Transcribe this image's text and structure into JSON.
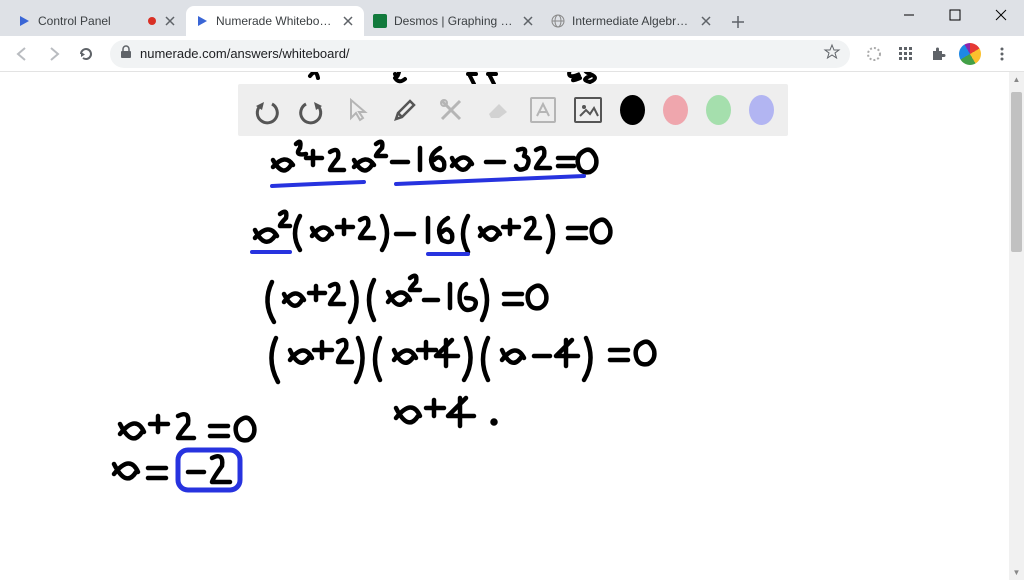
{
  "window": {
    "title": "Numerade Whiteboard"
  },
  "tabs": [
    {
      "label": "Control Panel",
      "active": false,
      "audio": true,
      "favicon": "numerade"
    },
    {
      "label": "Numerade Whiteboard",
      "active": true,
      "audio": false,
      "favicon": "numerade"
    },
    {
      "label": "Desmos | Graphing Calculator",
      "active": false,
      "audio": false,
      "favicon": "desmos"
    },
    {
      "label": "Intermediate Algebra for Colle",
      "active": false,
      "audio": false,
      "favicon": "globe"
    }
  ],
  "omnibox": {
    "url": "numerade.com/answers/whiteboard/"
  },
  "whiteboard": {
    "tools": [
      "undo",
      "redo",
      "pointer",
      "pencil",
      "crossed-tools",
      "eraser",
      "text",
      "image"
    ],
    "colors": [
      "#000000",
      "#efa6ad",
      "#a5dfad",
      "#b2b5f2"
    ],
    "selected_color": "#000000"
  },
  "handwriting": {
    "lines": [
      "x^3 + 2x^2 - 16x - 32 = 0",
      "x^2 (x + 2) - 16 (x + 2) = 0",
      "(x + 2) (x^2 - 16) = 0",
      "(x + 2) (x + 4) (x - 4) = 0",
      "x + 2 = 0        x + 4 .",
      "x = [-2]"
    ],
    "boxed_answer": "-2"
  }
}
